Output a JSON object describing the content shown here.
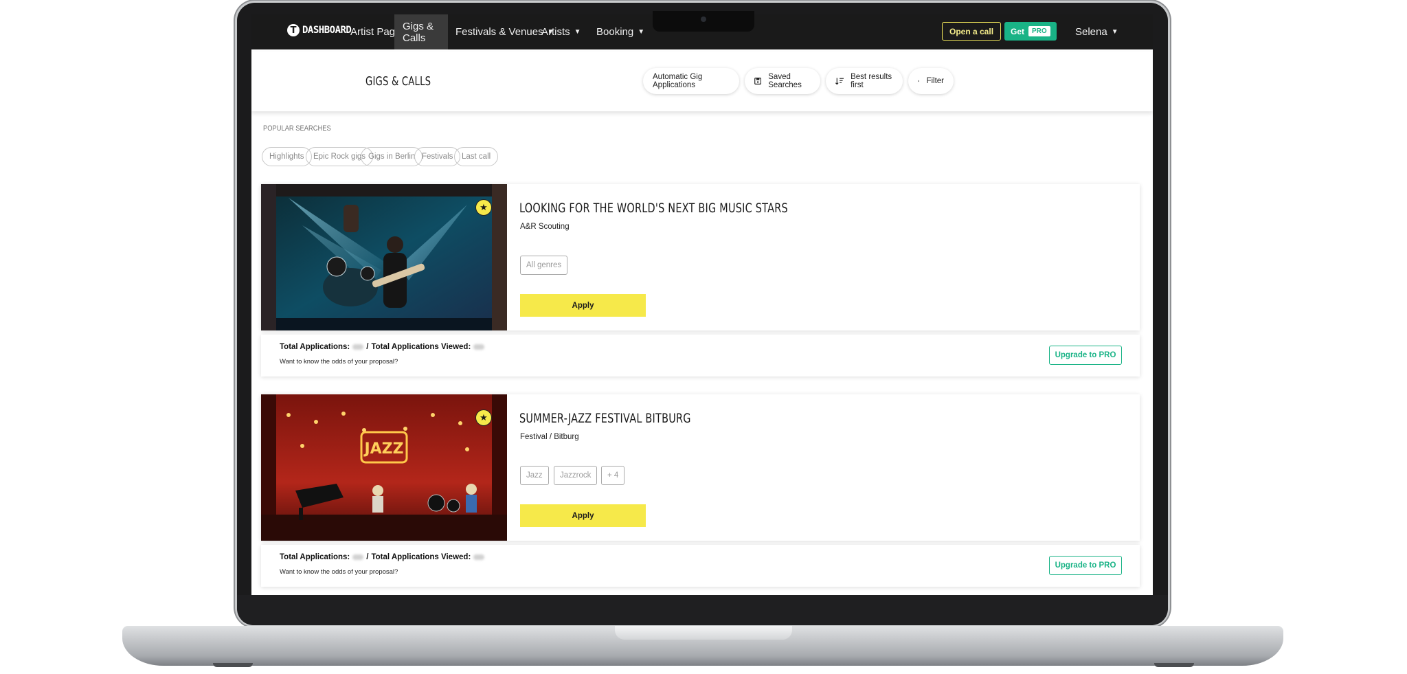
{
  "nav": {
    "logo_text": "DASHBOARD",
    "items": [
      {
        "label": "Artist Page"
      },
      {
        "label": "Gigs & Calls"
      },
      {
        "label": "Festivals & Venues"
      },
      {
        "label": "Artists"
      },
      {
        "label": "Booking"
      }
    ],
    "open_call_label": "Open a call",
    "get_label": "Get",
    "pro_label": "PRO",
    "user_name": "Selena"
  },
  "header": {
    "title": "GIGS & CALLS",
    "buttons": {
      "auto": "Automatic Gig Applications",
      "saved": "Saved Searches",
      "sort": "Best results first",
      "filter": "Filter"
    }
  },
  "popular": {
    "label": "Popular searches",
    "chips": [
      "Highlights",
      "Epic Rock gigs",
      "Gigs in Berlin",
      "Festivals",
      "Last call"
    ]
  },
  "cards": [
    {
      "title": "LOOKING FOR THE WORLD'S NEXT BIG MUSIC STARS",
      "subtitle": "A&R Scouting",
      "tags": [
        "All genres"
      ],
      "apply_label": "Apply",
      "stats_apps_label": "Total Applications:",
      "stats_sep": "/",
      "stats_viewed_label": "Total Applications Viewed:",
      "stats_prompt": "Want to know the odds of your proposal?",
      "upgrade_label": "Upgrade to PRO"
    },
    {
      "title": "SUMMER-JAZZ FESTIVAL BITBURG",
      "subtitle": "Festival / Bitburg",
      "tags": [
        "Jazz",
        "Jazzrock",
        "+ 4"
      ],
      "sign_text": "JAZZ",
      "apply_label": "Apply",
      "stats_apps_label": "Total Applications:",
      "stats_sep": "/",
      "stats_viewed_label": "Total Applications Viewed:",
      "stats_prompt": "Want to know the odds of your proposal?",
      "upgrade_label": "Upgrade to PRO"
    }
  ],
  "colors": {
    "accent_yellow": "#f6e94a",
    "pro_green": "#19b386",
    "nav_bg": "#1a1a1a"
  }
}
